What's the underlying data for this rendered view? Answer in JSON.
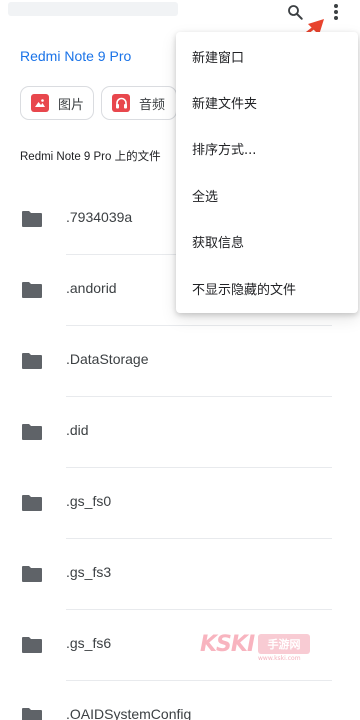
{
  "header": {
    "search_icon": "search-icon",
    "more_icon": "more-vert-icon"
  },
  "device_title": "Redmi Note 9 Pro",
  "chips": [
    {
      "label": "图片",
      "icon": "image-icon",
      "color": "#e8474d"
    },
    {
      "label": "音频",
      "icon": "headphones-icon",
      "color": "#e8474d"
    }
  ],
  "section_title": "Redmi Note 9 Pro 上的文件",
  "files": [
    {
      "name": ".7934039a"
    },
    {
      "name": ".andorid"
    },
    {
      "name": ".DataStorage"
    },
    {
      "name": ".did"
    },
    {
      "name": ".gs_fs0"
    },
    {
      "name": ".gs_fs3"
    },
    {
      "name": ".gs_fs6"
    },
    {
      "name": ".OAIDSystemConfig"
    }
  ],
  "menu": {
    "items": [
      {
        "label": "新建窗口"
      },
      {
        "label": "新建文件夹"
      },
      {
        "label": "排序方式..."
      },
      {
        "label": "全选"
      },
      {
        "label": "获取信息"
      },
      {
        "label": "不显示隐藏的文件"
      }
    ]
  },
  "annotation": {
    "color": "#e8442e"
  },
  "watermark": {
    "brand": "KSKI",
    "badge": "手游网",
    "url": "www.kski.com"
  },
  "colors": {
    "accent": "#1a73e8",
    "folder": "#5f6368",
    "chip_icon": "#e8474d"
  }
}
